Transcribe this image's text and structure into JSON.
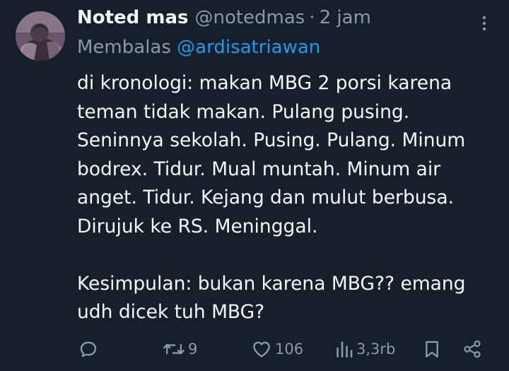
{
  "tweet": {
    "display_name": "Noted mas",
    "handle": "@notedmas",
    "separator": "·",
    "time": "2 jam",
    "reply_prefix": "Membalas",
    "reply_to": "@ardisatriawan",
    "body_lines": [
      "di kronologi: makan MBG 2 porsi karena",
      "teman tidak makan. Pulang pusing.",
      "Seninnya sekolah. Pusing. Pulang. Minum",
      "bodrex. Tidur. Mual muntah. Minum air",
      "anget. Tidur. Kejang dan mulut berbusa.",
      "Dirujuk ke RS. Meninggal."
    ],
    "body_lines_2": [
      "Kesimpulan: bukan karena MBG?? emang",
      "udh dicek tuh MBG?"
    ]
  },
  "actions": {
    "reply_icon": "reply-icon",
    "retweet_icon": "retweet-icon",
    "retweet_count": "9",
    "like_icon": "heart-icon",
    "like_count": "106",
    "views_icon": "views-icon",
    "views_count": "3,3rb",
    "bookmark_icon": "bookmark-icon",
    "share_icon": "share-icon"
  },
  "colors": {
    "background": "#15202b",
    "text": "#f7f9f9",
    "muted": "#8b98a5",
    "accent": "#1d9bf0"
  }
}
